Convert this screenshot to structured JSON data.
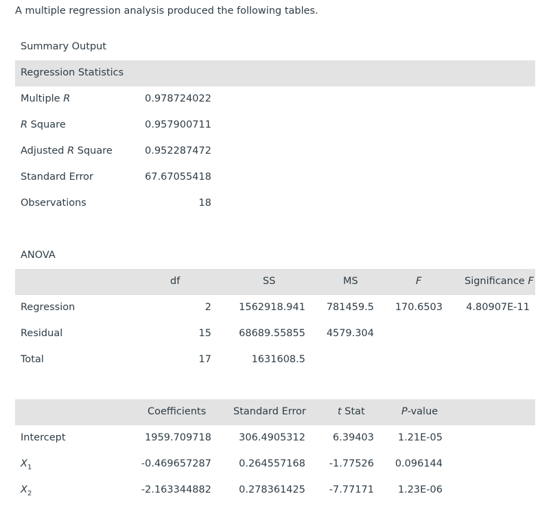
{
  "intro": "A multiple regression analysis produced the following tables.",
  "summary": {
    "title": "Summary Output",
    "header": "Regression Statistics",
    "rows": [
      {
        "pre": "Multiple ",
        "it": "R",
        "post": "",
        "value": "0.978724022"
      },
      {
        "pre": "",
        "it": "R",
        "post": " Square",
        "value": "0.957900711"
      },
      {
        "pre": "Adjusted ",
        "it": "R",
        "post": " Square",
        "value": "0.952287472"
      },
      {
        "pre": "Standard Error",
        "it": "",
        "post": "",
        "value": "67.67055418"
      },
      {
        "pre": "Observations",
        "it": "",
        "post": "",
        "value": "18"
      }
    ]
  },
  "anova": {
    "title": "ANOVA",
    "headers": {
      "df": "df",
      "ss": "SS",
      "ms": "MS",
      "f": "F",
      "sig_pre": "Significance ",
      "sig_it": "F"
    },
    "rows": [
      {
        "label": "Regression",
        "df": "2",
        "ss": "1562918.941",
        "ms": "781459.5",
        "f": "170.6503",
        "sig": "4.80907E-11"
      },
      {
        "label": "Residual",
        "df": "15",
        "ss": "68689.55855",
        "ms": "4579.304",
        "f": "",
        "sig": ""
      },
      {
        "label": "Total",
        "df": "17",
        "ss": "1631608.5",
        "ms": "",
        "f": "",
        "sig": ""
      }
    ]
  },
  "coefficients": {
    "headers": {
      "coef": "Coefficients",
      "se": "Standard Error",
      "t_it": "t",
      "t_post": " Stat",
      "p_it": "P",
      "p_post": "-value"
    },
    "rows": [
      {
        "label": "Intercept",
        "label_sub": "",
        "coef": "1959.709718",
        "se": "306.4905312",
        "t": "6.39403",
        "p": "1.21E-05"
      },
      {
        "label": "X",
        "label_sub": "1",
        "coef": "-0.469657287",
        "se": "0.264557168",
        "t": "-1.77526",
        "p": "0.096144"
      },
      {
        "label": "X",
        "label_sub": "2",
        "coef": "-2.163344882",
        "se": "0.278361425",
        "t": "-7.77171",
        "p": "1.23E-06"
      }
    ]
  }
}
